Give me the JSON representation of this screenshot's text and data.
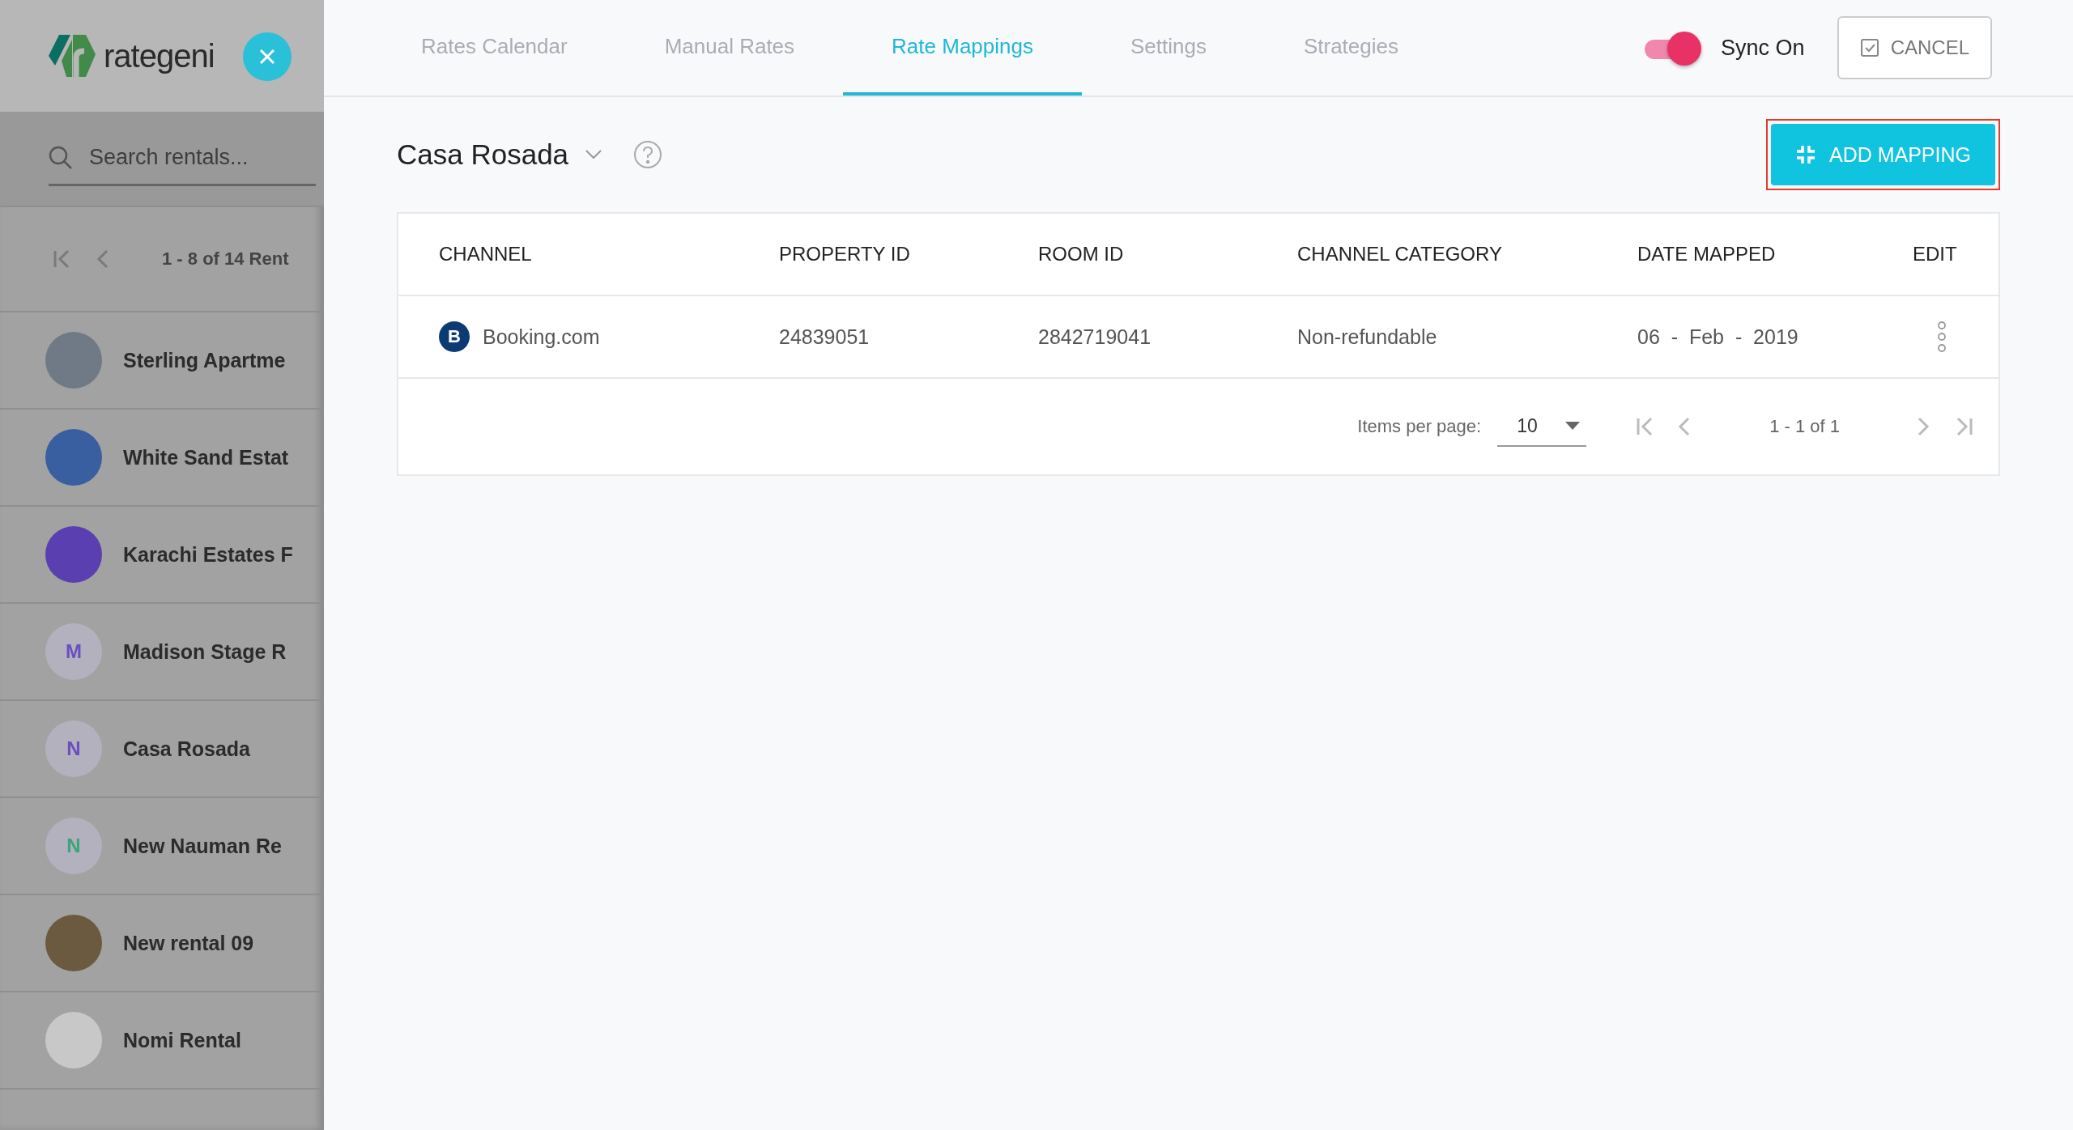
{
  "sidebar": {
    "logo_text": "rategeni",
    "search": {
      "placeholder": "Search rentals..."
    },
    "paginator": {
      "range": "1 - 8 of 14 Rent"
    },
    "rentals": [
      {
        "name": "Sterling Apartme",
        "avatar": {
          "kind": "photo",
          "color": "#6f7a86"
        }
      },
      {
        "name": "White Sand Estat",
        "avatar": {
          "kind": "photo",
          "color": "#3a5fa0"
        }
      },
      {
        "name": "Karachi Estates F",
        "avatar": {
          "kind": "photo",
          "color": "#5a3fb0"
        }
      },
      {
        "name": "Madison Stage R",
        "avatar": {
          "kind": "letter",
          "letter": "M",
          "color": "#6a4fc0"
        }
      },
      {
        "name": "Casa Rosada",
        "avatar": {
          "kind": "letter",
          "letter": "N",
          "color": "#6a4fc0"
        }
      },
      {
        "name": "New Nauman Re",
        "avatar": {
          "kind": "letter",
          "letter": "N",
          "color": "#3aa57a"
        }
      },
      {
        "name": "New rental 09",
        "avatar": {
          "kind": "photo",
          "color": "#6b5a40"
        }
      },
      {
        "name": "Nomi Rental",
        "avatar": {
          "kind": "photo",
          "color": "#c8c8c8"
        }
      }
    ]
  },
  "tabs": [
    {
      "label": "Rates Calendar",
      "selected": false
    },
    {
      "label": "Manual Rates",
      "selected": false
    },
    {
      "label": "Rate Mappings",
      "selected": true
    },
    {
      "label": "Settings",
      "selected": false
    },
    {
      "label": "Strategies",
      "selected": false
    }
  ],
  "sync": {
    "label": "Sync On",
    "on": true
  },
  "cancel_button": {
    "label": "CANCEL"
  },
  "rental_select": {
    "value": "Casa Rosada"
  },
  "add_button": {
    "label": "ADD MAPPING",
    "highlighted": true
  },
  "table": {
    "columns": [
      "CHANNEL",
      "PROPERTY ID",
      "ROOM ID",
      "CHANNEL CATEGORY",
      "DATE MAPPED",
      "EDIT"
    ],
    "rows": [
      {
        "channel_logo": "B",
        "channel": "Booking.com",
        "property_id": "24839051",
        "room_id": "2842719041",
        "category": "Non-refundable",
        "date": "06  -  Feb  -  2019"
      }
    ]
  },
  "paginator": {
    "label": "Items per page:",
    "page_size": "10",
    "range": "1 - 1 of 1"
  }
}
